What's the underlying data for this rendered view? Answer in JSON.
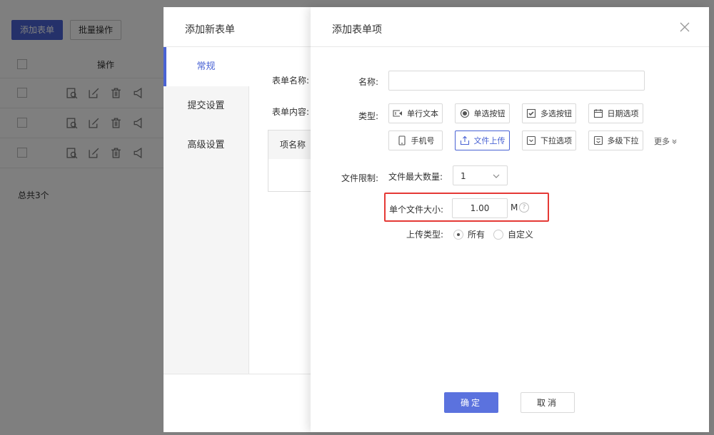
{
  "base": {
    "add_form_label": "添加表单",
    "batch_label": "批量操作",
    "table_header_ops": "操作",
    "total_text": "总共3个"
  },
  "mid_dialog": {
    "title": "添加新表单",
    "nav": [
      "常规",
      "提交设置",
      "高级设置"
    ],
    "form_name_label": "表单名称:",
    "form_content_label": "表单内容:",
    "table_header_item_name": "项名称"
  },
  "dialog": {
    "title": "添加表单项",
    "name_label": "名称:",
    "name_value": "",
    "type_label": "类型:",
    "types": [
      {
        "label": "单行文本",
        "icon": "single-line-text-icon"
      },
      {
        "label": "单选按钮",
        "icon": "radio-icon"
      },
      {
        "label": "多选按钮",
        "icon": "checkbox-icon"
      },
      {
        "label": "日期选项",
        "icon": "calendar-icon"
      },
      {
        "label": "手机号",
        "icon": "phone-icon"
      },
      {
        "label": "文件上传",
        "icon": "upload-icon",
        "selected": true
      },
      {
        "label": "下拉选项",
        "icon": "dropdown-icon"
      },
      {
        "label": "多级下拉",
        "icon": "multi-level-icon"
      }
    ],
    "more_label": "更多",
    "file_limit_label": "文件限制:",
    "max_count_label": "文件最大数量:",
    "max_count_value": "1",
    "single_size_label": "单个文件大小:",
    "single_size_value": "1.00",
    "size_unit": "M",
    "help_mark": "?",
    "upload_type_label": "上传类型:",
    "upload_type_options": [
      {
        "label": "所有",
        "checked": true
      },
      {
        "label": "自定义",
        "checked": false
      }
    ],
    "ok_label": "确定",
    "cancel_label": "取消"
  },
  "colors": {
    "primary": "#4a63d4",
    "highlight_border": "#e53935"
  }
}
